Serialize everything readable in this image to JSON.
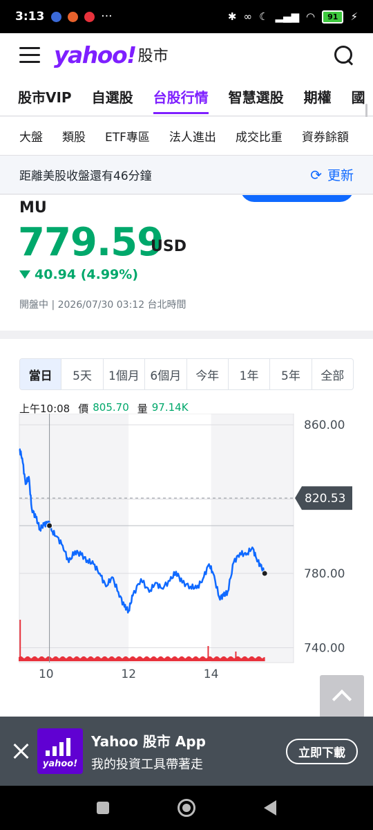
{
  "status_bar": {
    "time": "3:13",
    "more": "···",
    "battery": "91"
  },
  "header": {
    "logo": "yahoo!",
    "logo_sub": "股市"
  },
  "main_tabs": [
    {
      "label": "股市VIP",
      "active": false
    },
    {
      "label": "自選股",
      "active": false
    },
    {
      "label": "台股行情",
      "active": true
    },
    {
      "label": "智慧選股",
      "active": false
    },
    {
      "label": "期權",
      "active": false
    },
    {
      "label": "國",
      "active": false
    }
  ],
  "sub_tabs": [
    "大盤",
    "類股",
    "ETF專區",
    "法人進出",
    "成交比重",
    "資券餘額"
  ],
  "notice": {
    "text": "距離美股收盤還有46分鐘",
    "refresh_label": "更新"
  },
  "quote": {
    "symbol": "MU",
    "price": "779.59",
    "currency": "USD",
    "change": "40.94 (4.99%)",
    "meta": "開盤中 | 2026/07/30 03:12 台北時間"
  },
  "ranges": [
    {
      "label": "當日",
      "active": true
    },
    {
      "label": "5天",
      "active": false
    },
    {
      "label": "1個月",
      "active": false
    },
    {
      "label": "6個月",
      "active": false
    },
    {
      "label": "今年",
      "active": false
    },
    {
      "label": "1年",
      "active": false
    },
    {
      "label": "5年",
      "active": false
    },
    {
      "label": "全部",
      "active": false
    }
  ],
  "readout": {
    "time": "上午10:08",
    "price_label": "價",
    "price": "805.70",
    "volume_label": "量",
    "volume": "97.14K"
  },
  "chart_data": {
    "type": "line",
    "x_ticks": [
      "10",
      "12",
      "14"
    ],
    "y_ticks": [
      860,
      780,
      740
    ],
    "y_tick_labels": [
      "860.00",
      "780.00",
      "740.00"
    ],
    "ylim": [
      732,
      866
    ],
    "reference_value": 820.53,
    "reference_label": "820.53",
    "x_range": [
      9.35,
      16.0
    ],
    "series": [
      {
        "color": "#0f69ff",
        "x": [
          9.35,
          9.42,
          9.5,
          9.58,
          9.65,
          9.75,
          9.85,
          9.95,
          10.05,
          10.13,
          10.25,
          10.4,
          10.55,
          10.7,
          10.85,
          11.0,
          11.15,
          11.3,
          11.45,
          11.6,
          11.75,
          11.9,
          12.0,
          12.1,
          12.3,
          12.5,
          12.65,
          12.8,
          13.0,
          13.15,
          13.3,
          13.5,
          13.65,
          13.8,
          13.95,
          14.05,
          14.2,
          14.3,
          14.4,
          14.55,
          14.7,
          14.85,
          15.0,
          15.1,
          15.2,
          15.3
        ],
        "y": [
          847,
          842,
          828,
          832,
          815,
          810,
          804,
          806,
          808,
          803,
          800,
          795,
          786,
          792,
          790,
          787,
          785,
          780,
          773,
          778,
          770,
          762,
          760,
          768,
          777,
          770,
          775,
          772,
          776,
          781,
          775,
          773,
          772,
          777,
          785,
          780,
          767,
          768,
          770,
          786,
          791,
          790,
          794,
          788,
          784,
          780
        ]
      }
    ],
    "volume": {
      "color": "#e8323c",
      "typical": 4,
      "spikes": [
        {
          "x": 9.37,
          "v": 60
        },
        {
          "x": 13.93,
          "v": 22
        },
        {
          "x": 14.6,
          "v": 14
        }
      ]
    },
    "marker": {
      "x": 10.08,
      "y": 805.7
    },
    "last_point": {
      "x": 15.3,
      "y": 780
    },
    "grid": true
  },
  "banner": {
    "title": "Yahoo 股市 App",
    "subtitle": "我的投資工具帶著走",
    "download_label": "立即下載",
    "icon_text": "yahoo!"
  },
  "colors": {
    "brand": "#7e1fff",
    "up_down": "#00a86b",
    "link": "#0f69ff"
  }
}
